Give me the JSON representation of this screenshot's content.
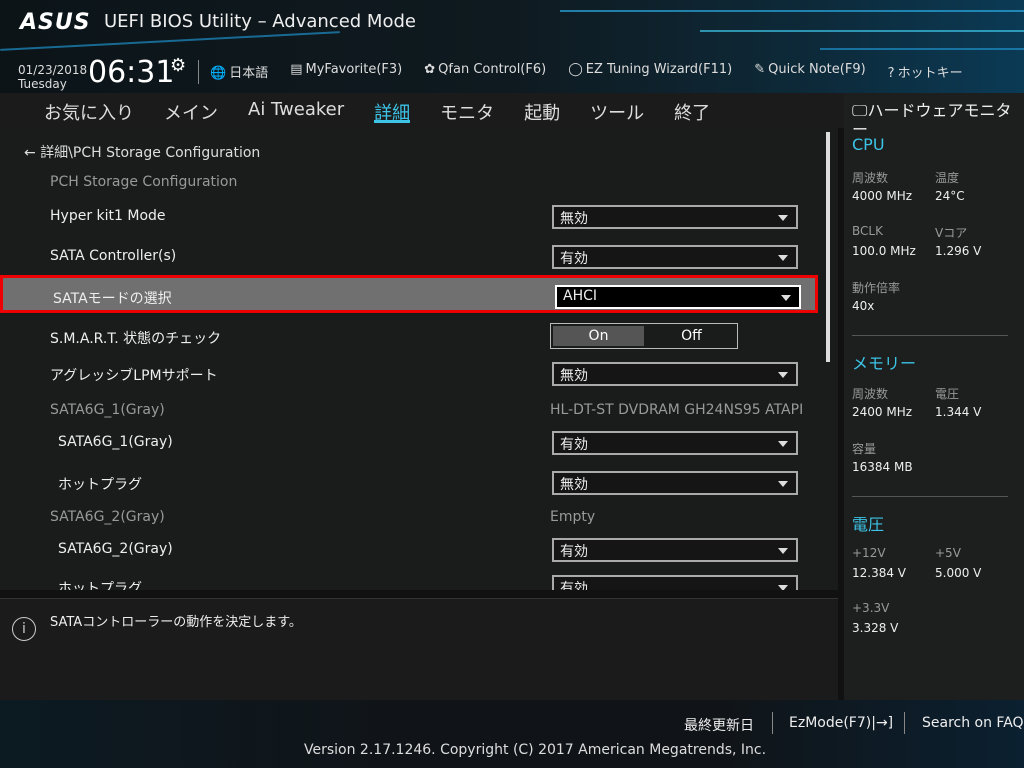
{
  "header": {
    "logo": "ASUS",
    "title": "UEFI BIOS Utility – Advanced Mode",
    "date": "01/23/2018",
    "day": "Tuesday",
    "time": "06:31",
    "tools": [
      {
        "icon": "globe-icon",
        "glyph": "🌐",
        "label": "日本語"
      },
      {
        "icon": "favorite-icon",
        "glyph": "▤",
        "label": "MyFavorite(F3)"
      },
      {
        "icon": "fan-icon",
        "glyph": "✿",
        "label": "Qfan Control(F6)"
      },
      {
        "icon": "bulb-icon",
        "glyph": "◯",
        "label": "EZ Tuning Wizard(F11)"
      },
      {
        "icon": "note-icon",
        "glyph": "✎",
        "label": "Quick Note(F9)"
      },
      {
        "icon": "hotkey-icon",
        "glyph": "?",
        "label": "ホットキー"
      }
    ]
  },
  "tabs": [
    {
      "label": "お気に入り"
    },
    {
      "label": "メイン"
    },
    {
      "label": "Ai Tweaker"
    },
    {
      "label": "詳細",
      "active": true
    },
    {
      "label": "モニタ"
    },
    {
      "label": "起動"
    },
    {
      "label": "ツール"
    },
    {
      "label": "終了"
    }
  ],
  "breadcrumb": "詳細\\PCH Storage Configuration",
  "rows": [
    {
      "label": "PCH Storage Configuration",
      "type": "heading"
    },
    {
      "label": "Hyper kit1 Mode",
      "type": "dropdown",
      "value": "無効"
    },
    {
      "label": "SATA Controller(s)",
      "type": "dropdown",
      "value": "有効"
    },
    {
      "label": "SATAモードの選択",
      "type": "dropdown",
      "value": "AHCI",
      "selected": true
    },
    {
      "label": "S.M.A.R.T. 状態のチェック",
      "type": "toggle",
      "on": "On",
      "off": "Off",
      "value": "On"
    },
    {
      "label": "アグレッシブLPMサポート",
      "type": "dropdown",
      "value": "無効"
    },
    {
      "label": "SATA6G_1(Gray)",
      "type": "info",
      "value": "HL-DT-ST DVDRAM GH24NS95 ATAPI"
    },
    {
      "label": "SATA6G_1(Gray)",
      "type": "dropdown",
      "value": "有効",
      "sub": true
    },
    {
      "label": "ホットプラグ",
      "type": "dropdown",
      "value": "無効",
      "sub": true
    },
    {
      "label": "SATA6G_2(Gray)",
      "type": "info",
      "value": "Empty"
    },
    {
      "label": "SATA6G_2(Gray)",
      "type": "dropdown",
      "value": "有効",
      "sub": true
    },
    {
      "label": "ホットプラグ",
      "type": "dropdown",
      "value": "有効",
      "sub": true
    }
  ],
  "help": "SATAコントローラーの動作を決定します。",
  "hw": {
    "title": "ハードウェアモニター",
    "cpu": {
      "title": "CPU",
      "freq_k": "周波数",
      "freq": "4000 MHz",
      "temp_k": "温度",
      "temp": "24°C",
      "bclk_k": "BCLK",
      "bclk": "100.0 MHz",
      "vcore_k": "Vコア",
      "vcore": "1.296 V",
      "ratio_k": "動作倍率",
      "ratio": "40x"
    },
    "mem": {
      "title": "メモリー",
      "freq_k": "周波数",
      "freq": "2400 MHz",
      "volt_k": "電圧",
      "volt": "1.344 V",
      "cap_k": "容量",
      "cap": "16384 MB"
    },
    "volt": {
      "title": "電圧",
      "v12_k": "+12V",
      "v12": "12.384 V",
      "v5_k": "+5V",
      "v5": "5.000 V",
      "v33_k": "+3.3V",
      "v33": "3.328 V"
    }
  },
  "footer": {
    "last": "最終更新日",
    "ez": "EzMode(F7)|→]",
    "faq": "Search on FAQ",
    "copyright": "Version 2.17.1246. Copyright (C) 2017 American Megatrends, Inc."
  },
  "colors": {
    "accent": "#3cc3e6",
    "highlight_border": "#e00000"
  }
}
